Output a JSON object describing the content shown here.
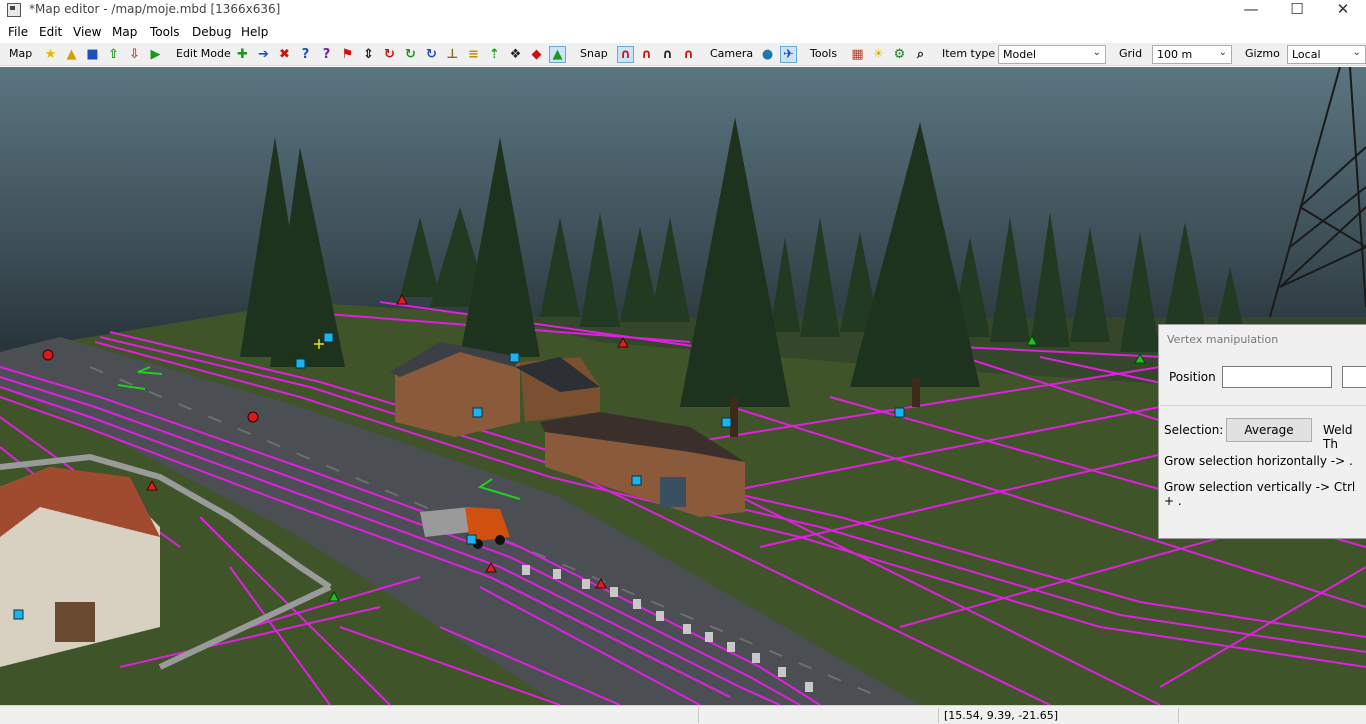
{
  "window": {
    "title": "*Map editor - /map/moje.mbd [1366x636]",
    "minimize": "—",
    "maximize": "☐",
    "close": "✕"
  },
  "menu": [
    "File",
    "Edit",
    "View",
    "Map",
    "Tools",
    "Debug",
    "Help"
  ],
  "toolbar": {
    "map_label": "Map",
    "edit_mode_label": "Edit Mode",
    "snap_label": "Snap",
    "camera_label": "Camera",
    "tools_label": "Tools",
    "item_type_label": "Item type",
    "item_type_value": "Model",
    "grid_label": "Grid",
    "grid_value": "100 m",
    "gizmo_label": "Gizmo",
    "gizmo_value": "Local",
    "icons": {
      "map": [
        "favorite-star-icon",
        "open-folder-icon",
        "save-icon",
        "export-icon",
        "import-icon",
        "play-icon"
      ],
      "edit": [
        "add-icon",
        "move-arrow-icon",
        "delete-icon",
        "help-icon",
        "question-icon",
        "flag-icon",
        "elevation-icon",
        "rotate-x-icon",
        "rotate-y-icon",
        "rotate-z-icon",
        "terrain-icon",
        "terrain-edit-icon",
        "raise-icon",
        "prefab-icon",
        "vehicle-icon",
        "tree-brush-icon"
      ],
      "snap": [
        "magnet-icon",
        "magnet-plus-icon",
        "magnet-vertex-icon",
        "magnet-edge-icon"
      ],
      "camera": [
        "globe-icon",
        "free-camera-icon"
      ],
      "tools": [
        "palette-icon",
        "sun-icon",
        "gear-icon",
        "search-icon"
      ]
    },
    "colors": {
      "green": "#1a9a1a",
      "blue": "#1f4fbf",
      "red": "#cc1111",
      "dark": "#222222",
      "gold": "#e8b800"
    }
  },
  "vertex_panel": {
    "title": "Vertex manipulation",
    "position_label": "Position",
    "position_x": "",
    "position_y": "",
    "selection_label": "Selection:",
    "average_button": "Average",
    "weld_label": "Weld Th",
    "grow_h": "Grow selection horizontally -> .",
    "grow_v": "Grow selection vertically -> Ctrl + ."
  },
  "status": {
    "coords": "[15.54, 9.39, -21.65]"
  },
  "scene_colors": {
    "sky_top": "#556f7a",
    "sky_bottom": "#1f2a30",
    "grass": "#40552a",
    "road": "#4a4d50",
    "grid_lines": "#e020e0",
    "node_square": "#1ab4f0",
    "node_triangle_red": "#e02020",
    "node_triangle_green": "#20c020",
    "trees": "#243a24"
  }
}
